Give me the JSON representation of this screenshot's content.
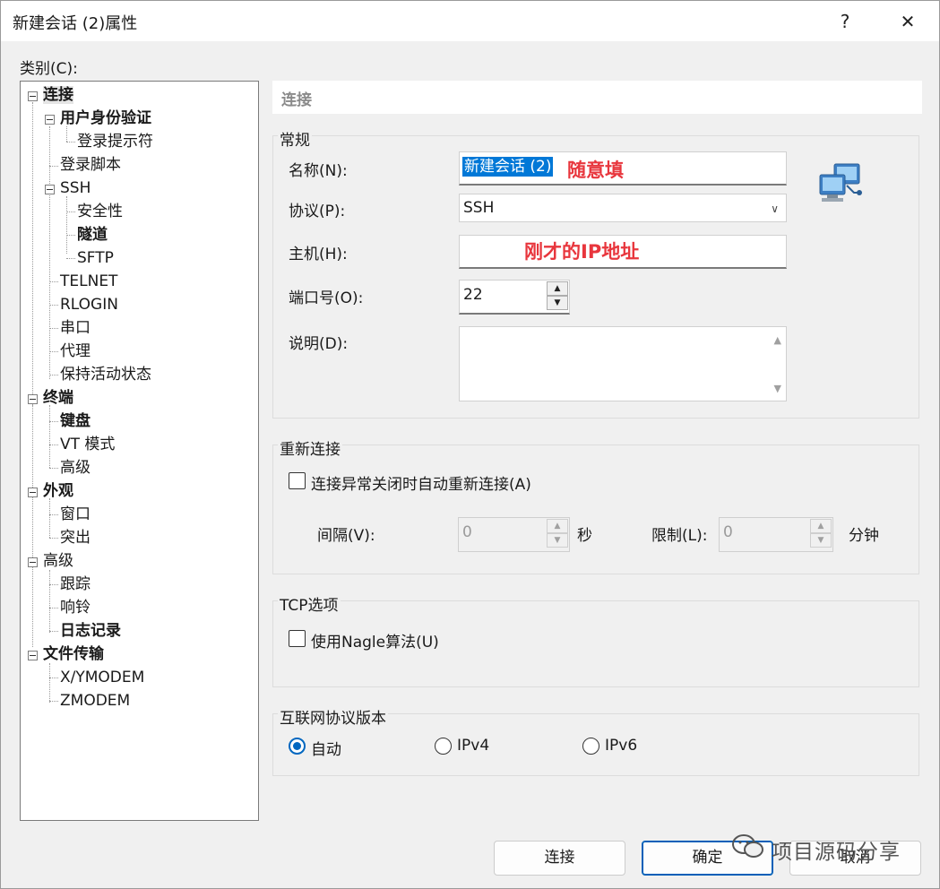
{
  "window": {
    "title": "新建会话 (2)属性",
    "help": "?",
    "close": "✕"
  },
  "category_label": "类别(C):",
  "tree": {
    "connect": "连接",
    "auth": "用户身份验证",
    "login_prompt": "登录提示符",
    "login_script": "登录脚本",
    "ssh": "SSH",
    "security": "安全性",
    "tunnel": "隧道",
    "sftp": "SFTP",
    "telnet": "TELNET",
    "rlogin": "RLOGIN",
    "serial": "串口",
    "proxy": "代理",
    "keepalive": "保持活动状态",
    "terminal": "终端",
    "keyboard": "键盘",
    "vt_mode": "VT 模式",
    "advanced_term": "高级",
    "appearance": "外观",
    "window": "窗口",
    "highlight": "突出",
    "advanced": "高级",
    "trace": "跟踪",
    "bell": "响铃",
    "logging": "日志记录",
    "file_transfer": "文件传输",
    "xymodem": "X/YMODEM",
    "zmodem": "ZMODEM"
  },
  "panel_header": "连接",
  "general": {
    "title": "常规",
    "name_label": "名称(N):",
    "name_value": "新建会话 (2)",
    "name_note": "随意填",
    "protocol_label": "协议(P):",
    "protocol_value": "SSH",
    "host_label": "主机(H):",
    "host_note": "刚才的IP地址",
    "port_label": "端口号(O):",
    "port_value": "22",
    "desc_label": "说明(D):"
  },
  "reconnect": {
    "title": "重新连接",
    "auto_label": "连接异常关闭时自动重新连接(A)",
    "auto_checked": false,
    "interval_label": "间隔(V):",
    "interval_value": "0",
    "interval_unit": "秒",
    "limit_label": "限制(L):",
    "limit_value": "0",
    "limit_unit": "分钟"
  },
  "tcp": {
    "title": "TCP选项",
    "nagle_label": "使用Nagle算法(U)",
    "nagle_checked": false
  },
  "ip_version": {
    "title": "互联网协议版本",
    "options": [
      "自动",
      "IPv4",
      "IPv6"
    ],
    "selected": "自动"
  },
  "buttons": {
    "connect": "连接",
    "ok": "确定",
    "cancel": "取消"
  },
  "watermark": "项目源码分享",
  "colors": {
    "accent": "#0078d7",
    "annotation": "#e8363d"
  }
}
